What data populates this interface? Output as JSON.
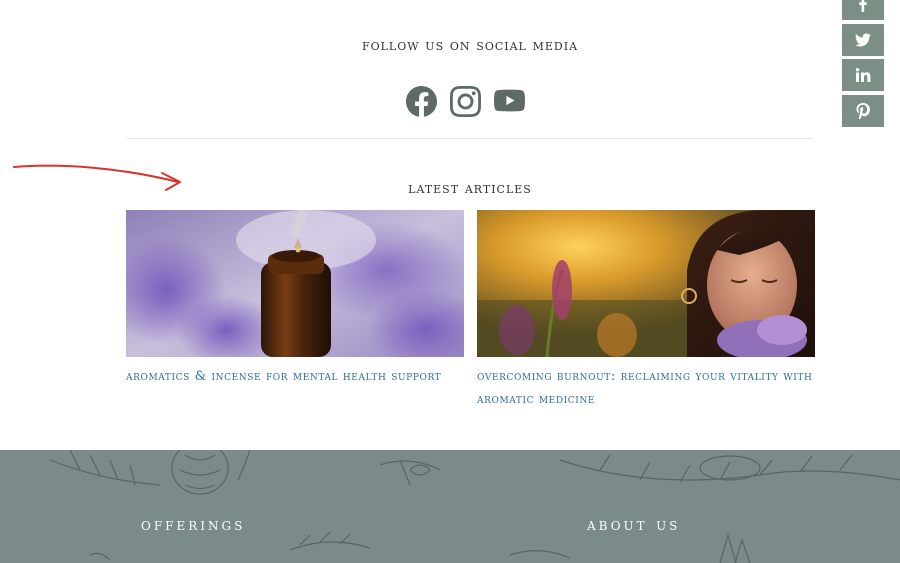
{
  "share_bar": {
    "buttons": [
      {
        "icon": "facebook-icon"
      },
      {
        "icon": "twitter-icon"
      },
      {
        "icon": "linkedin-icon"
      },
      {
        "icon": "pinterest-icon"
      }
    ]
  },
  "social": {
    "heading": "FOLLOW US ON SOCIAL MEDIA",
    "icons": [
      "facebook-icon",
      "instagram-icon",
      "youtube-icon"
    ]
  },
  "articles": {
    "heading": "LATEST ARTICLES",
    "items": [
      {
        "title": "AROMATICS & INCENSE FOR MENTAL HEALTH SUPPORT",
        "image": "lavender essential oil bottle with dropper"
      },
      {
        "title": "OVERCOMING BURNOUT: RECLAIMING YOUR VITALITY WITH AROMATIC MEDICINE",
        "image": "woman smelling lavender flowers in sunset light"
      }
    ]
  },
  "footer": {
    "offerings_label": "OFFERINGS",
    "about_label": "ABOUT US"
  },
  "colors": {
    "share_button": "#7b8f84",
    "social_icon": "#5d6a66",
    "article_link": "#2c6f98",
    "footer_bg": "#7b8a8b",
    "arrow": "#d9342b"
  }
}
